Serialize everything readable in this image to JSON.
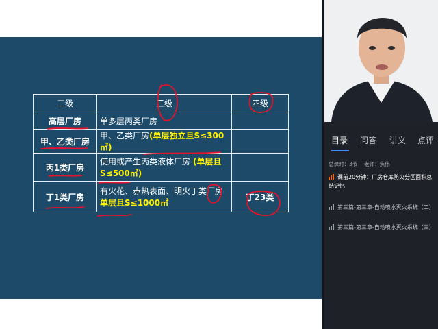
{
  "slide": {
    "headers": [
      "二级",
      "三级",
      "四级"
    ],
    "rows": [
      {
        "level2": "高层厂房",
        "level3_plain": "单多层丙类厂房",
        "level3_hl": "",
        "level4": ""
      },
      {
        "level2": "甲、乙类厂房",
        "level3_plain": "甲、乙类厂房",
        "level3_hl": "(单层独立且S≤300㎡)",
        "level4": ""
      },
      {
        "level2": "丙1类厂房",
        "level3_plain": "使用或产生丙类液体厂房",
        "level3_hl": "(单层且S≤500㎡)",
        "level4": ""
      },
      {
        "level2": "丁1类厂房",
        "level3_plain": "有火花、赤热表面、明火丁类厂房",
        "level3_hl": "单层且S≤1000㎡",
        "level4": "丁23类"
      }
    ]
  },
  "sidebar": {
    "tabs": [
      {
        "label": "目录",
        "active": true
      },
      {
        "label": "问答",
        "active": false
      },
      {
        "label": "讲义",
        "active": false
      },
      {
        "label": "点评",
        "active": false
      }
    ],
    "total_lessons": "总课时：3节",
    "teacher": "老师：焦伟",
    "items": [
      {
        "label": "课前20分钟：厂房仓库防火分区面积总结记忆",
        "active": true
      },
      {
        "label": "第三篇-第三章-自动喷水灭火系统（二）",
        "active": false
      },
      {
        "label": "第三篇-第三章-自动喷水灭火系统（三）",
        "active": false
      }
    ]
  },
  "colors": {
    "slide_bg": "#1c4a68",
    "highlight": "#fff200",
    "annotation": "#e0142c",
    "tab_active": "#3f8efc"
  }
}
